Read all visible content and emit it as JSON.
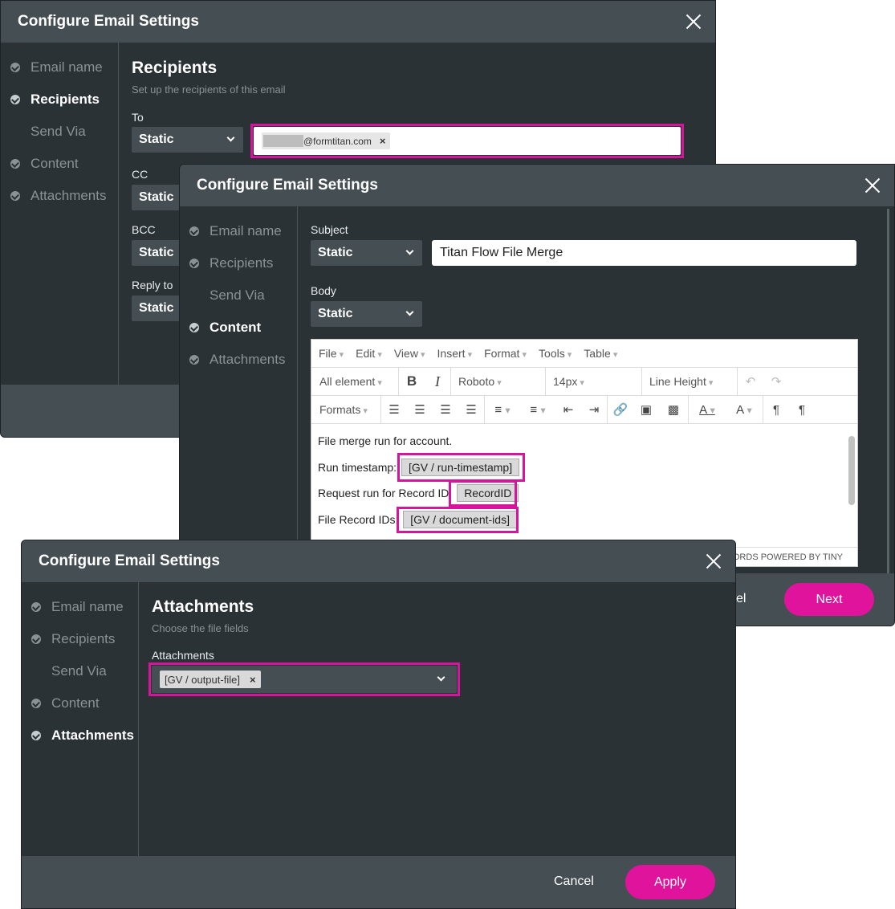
{
  "dialog_title": "Configure Email Settings",
  "steps": {
    "email_name": "Email name",
    "recipients": "Recipients",
    "send_via": "Send Via",
    "content": "Content",
    "attachments": "Attachments"
  },
  "recipients_dialog": {
    "title": "Recipients",
    "subtitle": "Set up the recipients of this email",
    "to_label": "To",
    "to_mode": "Static",
    "to_email_domain": "@formtitan.com",
    "to_email_remove": "×",
    "cc_label": "CC",
    "cc_mode": "Static",
    "bcc_label": "BCC",
    "bcc_mode": "Static",
    "reply_to_label": "Reply to",
    "reply_to_mode": "Static"
  },
  "content_dialog": {
    "subject_label": "Subject",
    "subject_mode": "Static",
    "subject_value": "Titan Flow File Merge",
    "body_label": "Body",
    "body_mode": "Static",
    "menu": [
      "File",
      "Edit",
      "View",
      "Insert",
      "Format",
      "Tools",
      "Table"
    ],
    "toolbar": {
      "element": "All element",
      "font": "Roboto",
      "size": "14px",
      "line_height": "Line Height",
      "formats": "Formats"
    },
    "body_lines": {
      "line1": "File merge run for account.",
      "line2_label": "Run timestamp:",
      "line2_token": "[GV / run-timestamp]",
      "line3_label": "Request run for Record ID:",
      "line3_token": "RecordID",
      "line4_label": "File Record IDs:",
      "line4_token": "[GV / document-ids]"
    },
    "statusbar": "ORDS POWERED BY TINY",
    "cancel_partial": "cel",
    "next_label": "Next"
  },
  "attachments_dialog": {
    "title": "Attachments",
    "subtitle": "Choose the file fields",
    "field_label": "Attachments",
    "token": "[GV / output-file]",
    "token_remove": "×",
    "cancel_label": "Cancel",
    "apply_label": "Apply"
  },
  "colors": {
    "accent": "#e0149c",
    "dialog_bg": "#2b3236",
    "header_bg": "#454e53",
    "highlight": "#d6159c"
  }
}
